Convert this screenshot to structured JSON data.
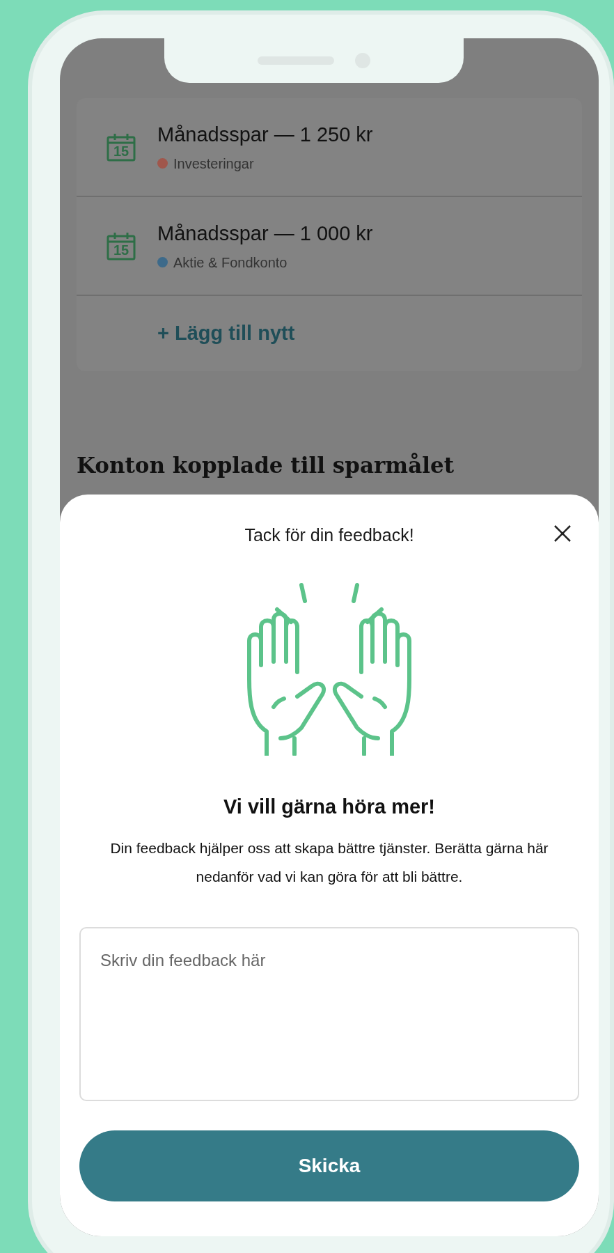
{
  "savings": [
    {
      "title": "Månadsspar — 1 250 kr",
      "icon_text": "15",
      "account": "Investeringar",
      "color": "#a0574c"
    },
    {
      "title": "Månadsspar — 1 000 kr",
      "icon_text": "15",
      "account": "Aktie & Fondkonto",
      "color": "#3d6a8a"
    }
  ],
  "add_link": "+ Lägg till nytt",
  "section_heading": "Konton kopplade till sparmålet",
  "sheet": {
    "title": "Tack för din feedback!",
    "heading": "Vi vill gärna höra mer!",
    "body": "Din feedback hjälper oss att skapa bättre tjänster. Berätta gärna här nedanför vad vi kan göra för att bli bättre.",
    "placeholder": "Skriv din feedback här",
    "submit": "Skicka"
  }
}
